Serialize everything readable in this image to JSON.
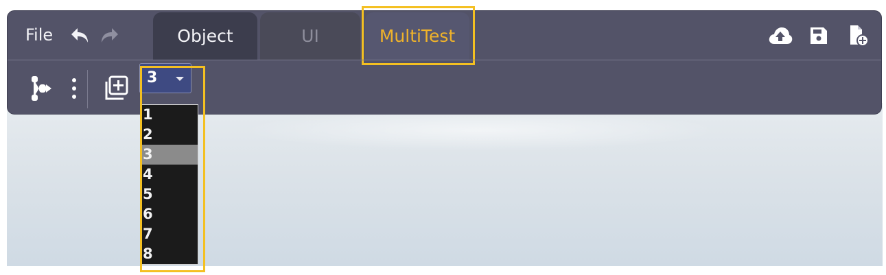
{
  "menu": {
    "file_label": "File"
  },
  "history": {
    "undo_icon": "undo-icon",
    "redo_icon": "redo-icon"
  },
  "tabs": [
    {
      "label": "Object",
      "state": "normal"
    },
    {
      "label": "UI",
      "state": "disabled"
    },
    {
      "label": "MultiTest",
      "state": "active"
    }
  ],
  "right_actions": [
    {
      "icon": "cloud-upload-icon"
    },
    {
      "icon": "save-icon"
    },
    {
      "icon": "new-file-icon"
    }
  ],
  "toolbar": {
    "tree_icon": "hierarchy-icon",
    "more_icon": "more-vertical-icon",
    "duplicate_icon": "duplicate-icon"
  },
  "count_select": {
    "value": "3",
    "options": [
      "1",
      "2",
      "3",
      "4",
      "5",
      "6",
      "7",
      "8"
    ],
    "selected_index": 2
  },
  "colors": {
    "panel": "#535368",
    "active_tab_text": "#f0b32a",
    "highlight": "#f4c021",
    "select_bg": "#3e4a82",
    "dropdown_bg": "#1b1b1b",
    "option_selected_bg": "#8b8b8b"
  }
}
